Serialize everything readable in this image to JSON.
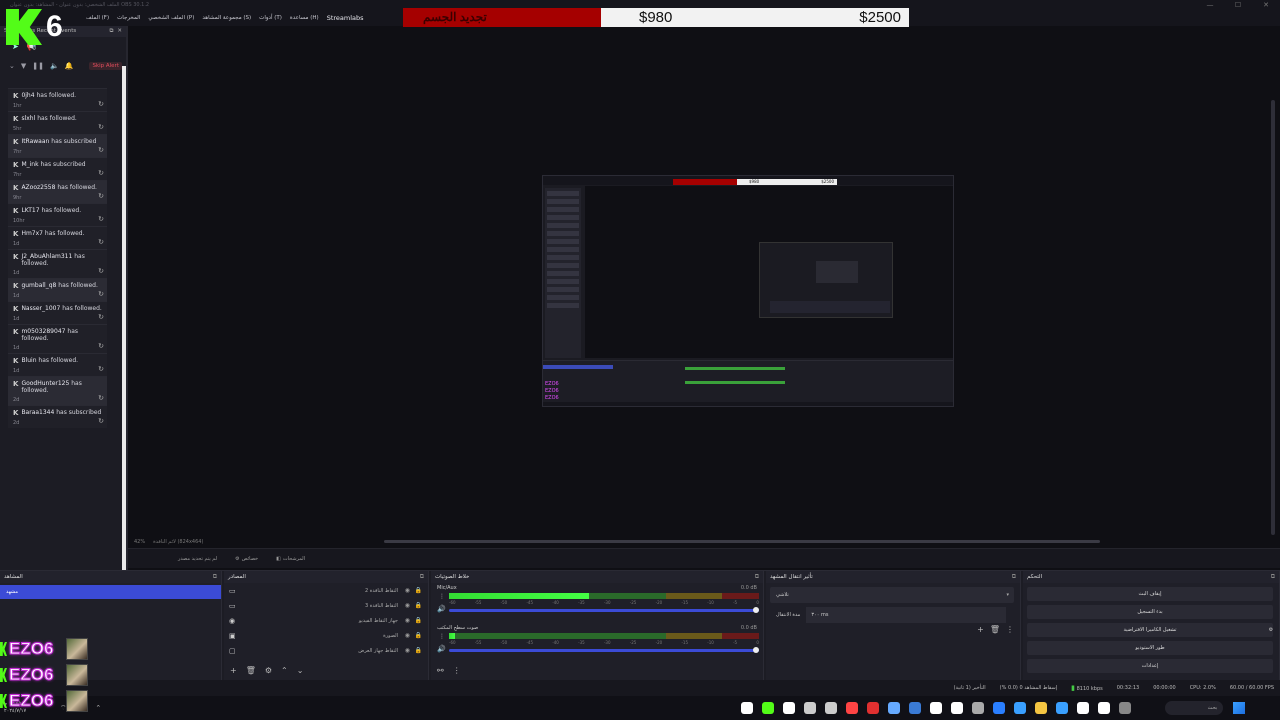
{
  "title_bar": {
    "text": "الملف الشخصي: بدون عنوان - المشاهد: بدون عنوان  OBS 30.1.2",
    "buttons": [
      "—",
      "☐",
      "✕"
    ]
  },
  "menu": [
    "الملف (F)",
    "المخرجات",
    "الملف الشخصي (P)",
    "مجموعة المشاهد (S)",
    "أدوات (T)",
    "مساعدة (H)",
    "Streamlabs"
  ],
  "logo": {
    "letter": "K",
    "number": "6",
    "color": "#53fc18"
  },
  "goal": {
    "label": "تجديد الجسم",
    "current": "$980",
    "target": "$2500",
    "progress": 0.39
  },
  "events_dock": {
    "title": "Streamlabs Recent Events",
    "skip_alert": "Skip Alert",
    "items": [
      {
        "user": "0jh4",
        "action": "has followed.",
        "time": "1hr",
        "shaded": false
      },
      {
        "user": "slxhl",
        "action": "has followed.",
        "time": "5hr",
        "shaded": false
      },
      {
        "user": "ItRawaan",
        "action": "has subscribed",
        "time": "7hr",
        "shaded": true
      },
      {
        "user": "M_ink",
        "action": "has subscribed",
        "time": "7hr",
        "shaded": false
      },
      {
        "user": "AZooz2558",
        "action": "has followed.",
        "time": "9hr",
        "shaded": true
      },
      {
        "user": "LKT17",
        "action": "has followed.",
        "time": "10hr",
        "shaded": false
      },
      {
        "user": "Hm7x7",
        "action": "has followed.",
        "time": "1d",
        "shaded": false
      },
      {
        "user": "J2_AbuAhlam311",
        "action": "has followed.",
        "time": "1d",
        "shaded": false
      },
      {
        "user": "gumball_q8",
        "action": "has followed.",
        "time": "1d",
        "shaded": true
      },
      {
        "user": "Nasser_1007",
        "action": "has followed.",
        "time": "1d",
        "shaded": false
      },
      {
        "user": "m0503289047",
        "action": "has followed.",
        "time": "1d",
        "shaded": false
      },
      {
        "user": "Bluin",
        "action": "has followed.",
        "time": "1d",
        "shaded": false
      },
      {
        "user": "GoodHunter125",
        "action": "has followed.",
        "time": "2d",
        "shaded": true
      },
      {
        "user": "Baraa1344",
        "action": "has subscribed",
        "time": "2d",
        "shaded": false
      }
    ]
  },
  "preview": {
    "zoom": "42%",
    "resolution": "لائم النافذة (824x464)",
    "inner_goal_current": "$980",
    "inner_goal_target": "$2500"
  },
  "context_bar": {
    "items": [
      "لم يتم تحديد مصدر",
      "خصائص",
      "المرشحات"
    ]
  },
  "scenes": {
    "title": "المشاهد",
    "selected": "مشهد"
  },
  "sources": {
    "title": "المصادر",
    "items": [
      {
        "name": "التقاط النافذة 2",
        "icon": "▭"
      },
      {
        "name": "التقاط النافذة 3",
        "icon": "▭"
      },
      {
        "name": "جهاز التقاط الفيديو",
        "icon": "◉"
      },
      {
        "name": "الصورة",
        "icon": "▣"
      },
      {
        "name": "التقاط جهاز العرض",
        "icon": "▢"
      }
    ]
  },
  "mixer": {
    "title": "خلاط الصوتيات",
    "channels": [
      {
        "name": "Mic/Aux",
        "db": "0.0 dB",
        "level": 0.45
      },
      {
        "name": "صوت سطح المكتب",
        "db": "0.0 dB",
        "level": 0.02
      }
    ],
    "ticks": [
      "-60",
      "-55",
      "-50",
      "-45",
      "-40",
      "-35",
      "-30",
      "-25",
      "-20",
      "-15",
      "-10",
      "-5",
      "0"
    ]
  },
  "transitions": {
    "title": "تأثير انتقال المشهد",
    "type": "تلاشي",
    "duration_label": "مدة الانتقال",
    "duration_value": "٣٠٠ ms"
  },
  "controls": {
    "title": "التحكم",
    "buttons": [
      "إيقاف البث",
      "بدء التسجيل",
      "تشغيل الكاميرا الافتراضية",
      "طور الاستوديو",
      "إعدادات"
    ]
  },
  "overlay": {
    "name": "EZO6",
    "count": 3
  },
  "status": {
    "frames": "إسقاط المشاهد 0 (0.0 %)",
    "delay": "التأخير (1 ثانية)",
    "bitrate": "8110 kbps",
    "stream_time": "00:32:13",
    "rec_time": "00:00:00",
    "cpu": "CPU: 2.0%",
    "fps": "60.00 / 60.00 FPS"
  },
  "taskbar": {
    "time": "١٢:٤٥ م",
    "date": "٢٠٢٤/٧/١٧",
    "search_placeholder": "بحث",
    "app_colors": [
      "#ffffff",
      "#53fc18",
      "#ffffff",
      "#cccccc",
      "#cccccc",
      "#ff4444",
      "#e03030",
      "#66aaff",
      "#3a7bd5",
      "#ffffff",
      "#ffffff",
      "#aaaaaa",
      "#2a7fff",
      "#3aa0ff",
      "#f4c542",
      "#3aa0ff",
      "#ffffff",
      "#ffffff",
      "#888888"
    ]
  }
}
